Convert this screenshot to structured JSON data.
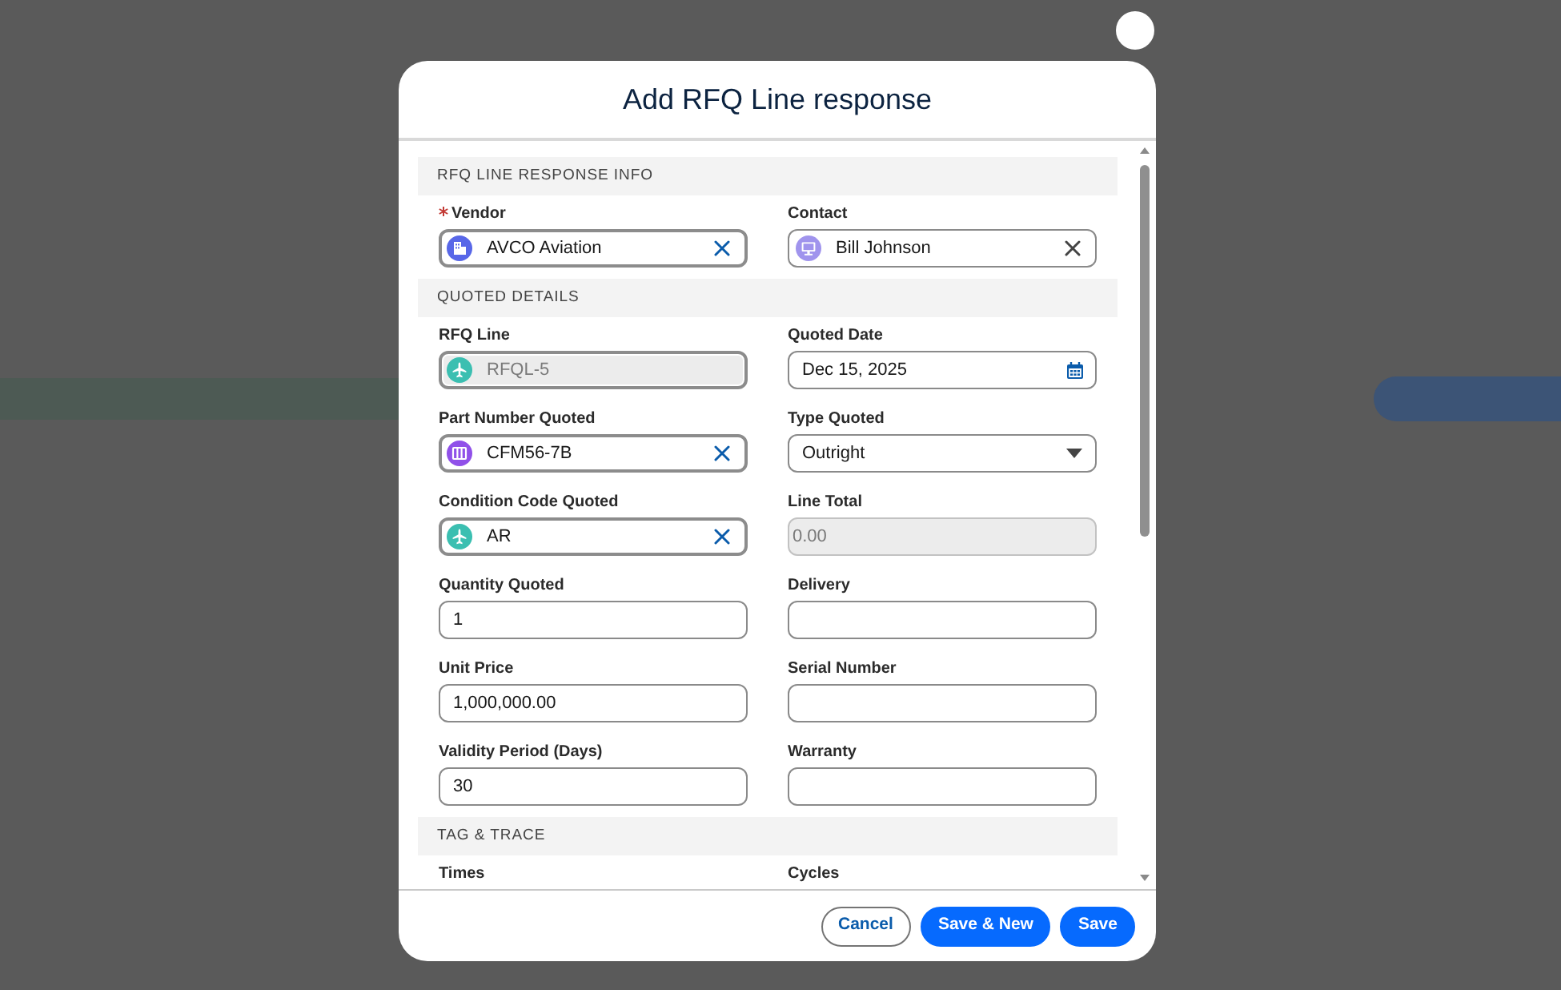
{
  "dialog": {
    "title": "Add RFQ Line response"
  },
  "sections": [
    {
      "title": "RFQ LINE RESPONSE INFO",
      "fields": [
        {
          "label": "Vendor",
          "kind": "lookup",
          "value": "AVCO Aviation",
          "required": true,
          "disabled": false,
          "highlighted": true,
          "color": "#5867e8"
        },
        {
          "label": "Contact",
          "kind": "lookup",
          "value": "Bill Johnson",
          "required": false,
          "disabled": false,
          "highlighted": false,
          "color": "#a094ed"
        }
      ]
    },
    {
      "title": "QUOTED DETAILS",
      "fields": [
        {
          "label": "RFQ Line",
          "kind": "lookup",
          "value": "RFQL-5",
          "required": false,
          "disabled": true,
          "highlighted": true,
          "color": "#3bbfb1"
        },
        {
          "label": "Quoted Date",
          "kind": "date",
          "value": "Dec 15, 2025",
          "required": false,
          "disabled": false
        },
        {
          "label": "Part Number Quoted",
          "kind": "lookup",
          "value": "CFM56-7B",
          "required": false,
          "disabled": false,
          "highlighted": true,
          "color": "#9050e9"
        },
        {
          "label": "Type Quoted",
          "kind": "picklist",
          "value": "Outright",
          "required": false,
          "disabled": false
        },
        {
          "label": "Condition Code Quoted",
          "kind": "lookup",
          "value": "AR",
          "required": false,
          "disabled": false,
          "highlighted": true,
          "color": "#3bbfb1"
        },
        {
          "label": "Line Total",
          "kind": "text",
          "value": "0.00",
          "required": false,
          "disabled": true
        },
        {
          "label": "Quantity Quoted",
          "kind": "text",
          "value": "1",
          "required": false,
          "disabled": false
        },
        {
          "label": "Delivery",
          "kind": "text",
          "required": false,
          "disabled": false
        },
        {
          "label": "Unit Price",
          "kind": "text",
          "value": "1,000,000.00",
          "required": false,
          "disabled": false
        },
        {
          "label": "Serial Number",
          "kind": "text",
          "required": false,
          "disabled": false
        },
        {
          "label": "Validity Period (Days)",
          "kind": "text",
          "value": "30",
          "required": false,
          "disabled": false
        },
        {
          "label": "Warranty",
          "kind": "text",
          "required": false,
          "disabled": false
        }
      ]
    },
    {
      "title": "TAG & TRACE",
      "fields": [
        {
          "label": "Times",
          "kind": "clipped",
          "required": false
        },
        {
          "label": "Cycles",
          "kind": "clipped",
          "required": false
        }
      ]
    }
  ],
  "buttons": [
    {
      "label": "Cancel",
      "kind": "neutral"
    },
    {
      "label": "Save & New",
      "kind": "brand"
    },
    {
      "label": "Save",
      "kind": "brand"
    }
  ]
}
